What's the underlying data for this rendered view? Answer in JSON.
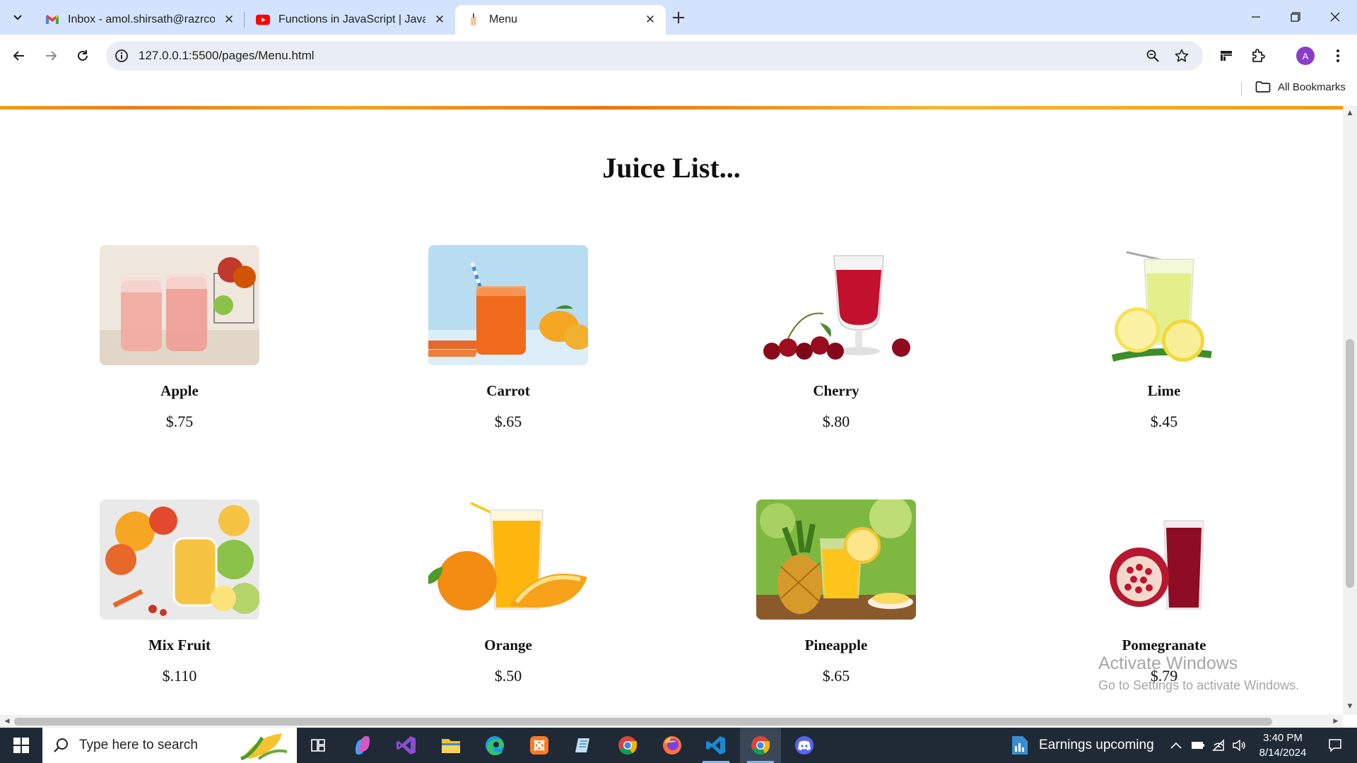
{
  "browser": {
    "tabs": [
      {
        "title": "Inbox - amol.shirsath@razrcorp",
        "icon": "gmail-icon",
        "active": false
      },
      {
        "title": "Functions in JavaScript | JavaScri",
        "icon": "youtube-icon",
        "active": false
      },
      {
        "title": "Menu",
        "icon": "page-favicon",
        "active": true
      }
    ],
    "url": "127.0.0.1:5500/pages/Menu.html",
    "bookmarks_all": "All Bookmarks",
    "profile_initial": "A",
    "colors": {
      "tabstrip": "#d3e3fd",
      "profile": "#8a3dc7"
    }
  },
  "page": {
    "title": "Juice List...",
    "accent_strip": "#f39c12",
    "items": [
      {
        "name": "Apple",
        "price": "$.75",
        "image": "apple-juice-image"
      },
      {
        "name": "Carrot",
        "price": "$.65",
        "image": "carrot-juice-image"
      },
      {
        "name": "Cherry",
        "price": "$.80",
        "image": "cherry-juice-image"
      },
      {
        "name": "Lime",
        "price": "$.45",
        "image": "lime-juice-image"
      },
      {
        "name": "Mix Fruit",
        "price": "$.110",
        "image": "mix-fruit-juice-image"
      },
      {
        "name": "Orange",
        "price": "$.50",
        "image": "orange-juice-image"
      },
      {
        "name": "Pineapple",
        "price": "$.65",
        "image": "pineapple-juice-image"
      },
      {
        "name": "Pomegranate",
        "price": "$.79",
        "image": "pomegranate-juice-image"
      }
    ]
  },
  "watermark": {
    "line1": "Activate Windows",
    "line2": "Go to Settings to activate Windows."
  },
  "taskbar": {
    "search_placeholder": "Type here to search",
    "news": "Earnings upcoming",
    "time": "3:40 PM",
    "date": "8/14/2024",
    "apps": [
      "task-view-icon",
      "copilot-icon",
      "visual-studio-icon",
      "file-explorer-icon",
      "edge-icon",
      "xampp-icon",
      "notepad-icon",
      "chrome-icon",
      "firefox-icon",
      "vscode-icon",
      "chrome-active-icon",
      "discord-icon"
    ]
  }
}
